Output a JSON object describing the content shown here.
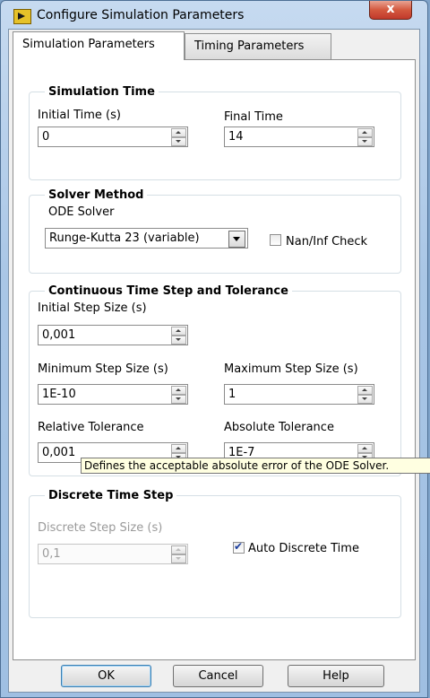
{
  "window": {
    "title": "Configure Simulation Parameters",
    "close_label": "x"
  },
  "tabs": [
    {
      "label": "Simulation Parameters",
      "active": true
    },
    {
      "label": "Timing Parameters",
      "active": false
    }
  ],
  "simulation_time": {
    "title": "Simulation Time",
    "initial_time": {
      "label": "Initial Time (s)",
      "value": "0"
    },
    "final_time": {
      "label": "Final Time",
      "value": "14"
    }
  },
  "solver_method": {
    "title": "Solver Method",
    "ode_label": "ODE Solver",
    "ode_value": "Runge-Kutta 23 (variable)",
    "naninf_label": "Nan/Inf Check",
    "naninf_checked": false
  },
  "continuous": {
    "title": "Continuous Time Step and Tolerance",
    "initial_step": {
      "label": "Initial Step Size (s)",
      "value": "0,001"
    },
    "min_step": {
      "label": "Minimum Step Size (s)",
      "value": "1E-10"
    },
    "max_step": {
      "label": "Maximum Step Size (s)",
      "value": "1"
    },
    "rel_tol": {
      "label": "Relative Tolerance",
      "value": "0,001"
    },
    "abs_tol": {
      "label": "Absolute Tolerance",
      "value": "1E-7"
    }
  },
  "tooltip": "Defines the acceptable absolute error of the ODE Solver.",
  "discrete": {
    "title": "Discrete Time Step",
    "step": {
      "label": "Discrete Step Size (s)",
      "value": "0,1"
    },
    "auto_label": "Auto Discrete Time",
    "auto_checked": true
  },
  "buttons": {
    "ok": "OK",
    "cancel": "Cancel",
    "help": "Help"
  }
}
